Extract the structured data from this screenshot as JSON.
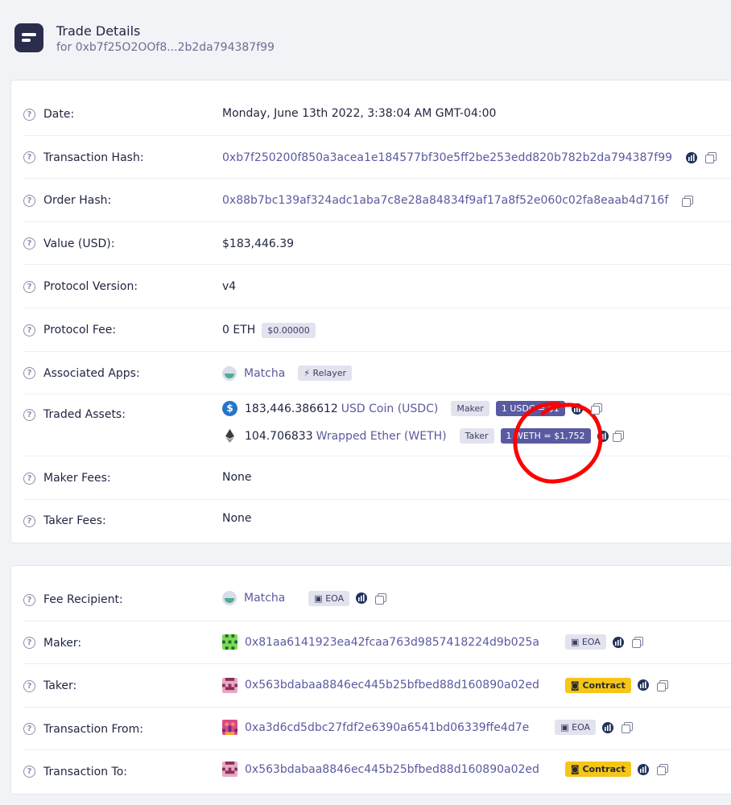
{
  "header": {
    "title": "Trade Details",
    "subtitle": "for 0xb7f25O2OOf8...2b2da794387f99"
  },
  "details": {
    "date": {
      "label": "Date:",
      "value": "Monday, June 13th 2022, 3:38:04 AM GMT-04:00"
    },
    "tx_hash": {
      "label": "Transaction Hash:",
      "value": "0xb7f250200f850a3acea1e184577bf30e5ff2be253edd820b782b2da794387f99"
    },
    "order_hash": {
      "label": "Order Hash:",
      "value": "0x88b7bc139af324adc1aba7c8e28a84834f9af17a8f52e060c02fa8eaab4d716f"
    },
    "value_usd": {
      "label": "Value (USD):",
      "value": "$183,446.39"
    },
    "protocol_version": {
      "label": "Protocol Version:",
      "value": "v4"
    },
    "protocol_fee": {
      "label": "Protocol Fee:",
      "value": "0 ETH",
      "usd_badge": "$0.00000"
    },
    "associated_apps": {
      "label": "Associated Apps:",
      "app": "Matcha",
      "badge": "Relayer"
    },
    "traded_assets": {
      "label": "Traded Assets:",
      "assets": [
        {
          "amount": "183,446.386612",
          "name": "USD Coin (USDC)",
          "role": "Maker",
          "rate": "1 USDC = $1",
          "icon": "usdc-icon"
        },
        {
          "amount": "104.706833",
          "name": "Wrapped Ether (WETH)",
          "role": "Taker",
          "rate": "1 WETH = $1,752",
          "icon": "eth-icon"
        }
      ]
    },
    "maker_fees": {
      "label": "Maker Fees:",
      "value": "None"
    },
    "taker_fees": {
      "label": "Taker Fees:",
      "value": "None"
    }
  },
  "parties": {
    "fee_recipient": {
      "label": "Fee Recipient:",
      "value": "Matcha",
      "badge": "EOA"
    },
    "maker": {
      "label": "Maker:",
      "value": "0x81aa6141923ea42fcaa763d9857418224d9b025a",
      "badge": "EOA"
    },
    "taker": {
      "label": "Taker:",
      "value": "0x563bdabaa8846ec445b25bfbed88d160890a02ed",
      "badge": "Contract"
    },
    "tx_from": {
      "label": "Transaction From:",
      "value": "0xa3d6cd5dbc27fdf2e6390a6541bd06339ffe4d7e",
      "badge": "EOA"
    },
    "tx_to": {
      "label": "Transaction To:",
      "value": "0x563bdabaa8846ec445b25bfbed88d160890a02ed",
      "badge": "Contract"
    }
  },
  "colors": {
    "accent": "#5a5aa2",
    "link": "#5b5aa0",
    "annotation": "#ff0000",
    "contract_badge": "#f5c518"
  }
}
